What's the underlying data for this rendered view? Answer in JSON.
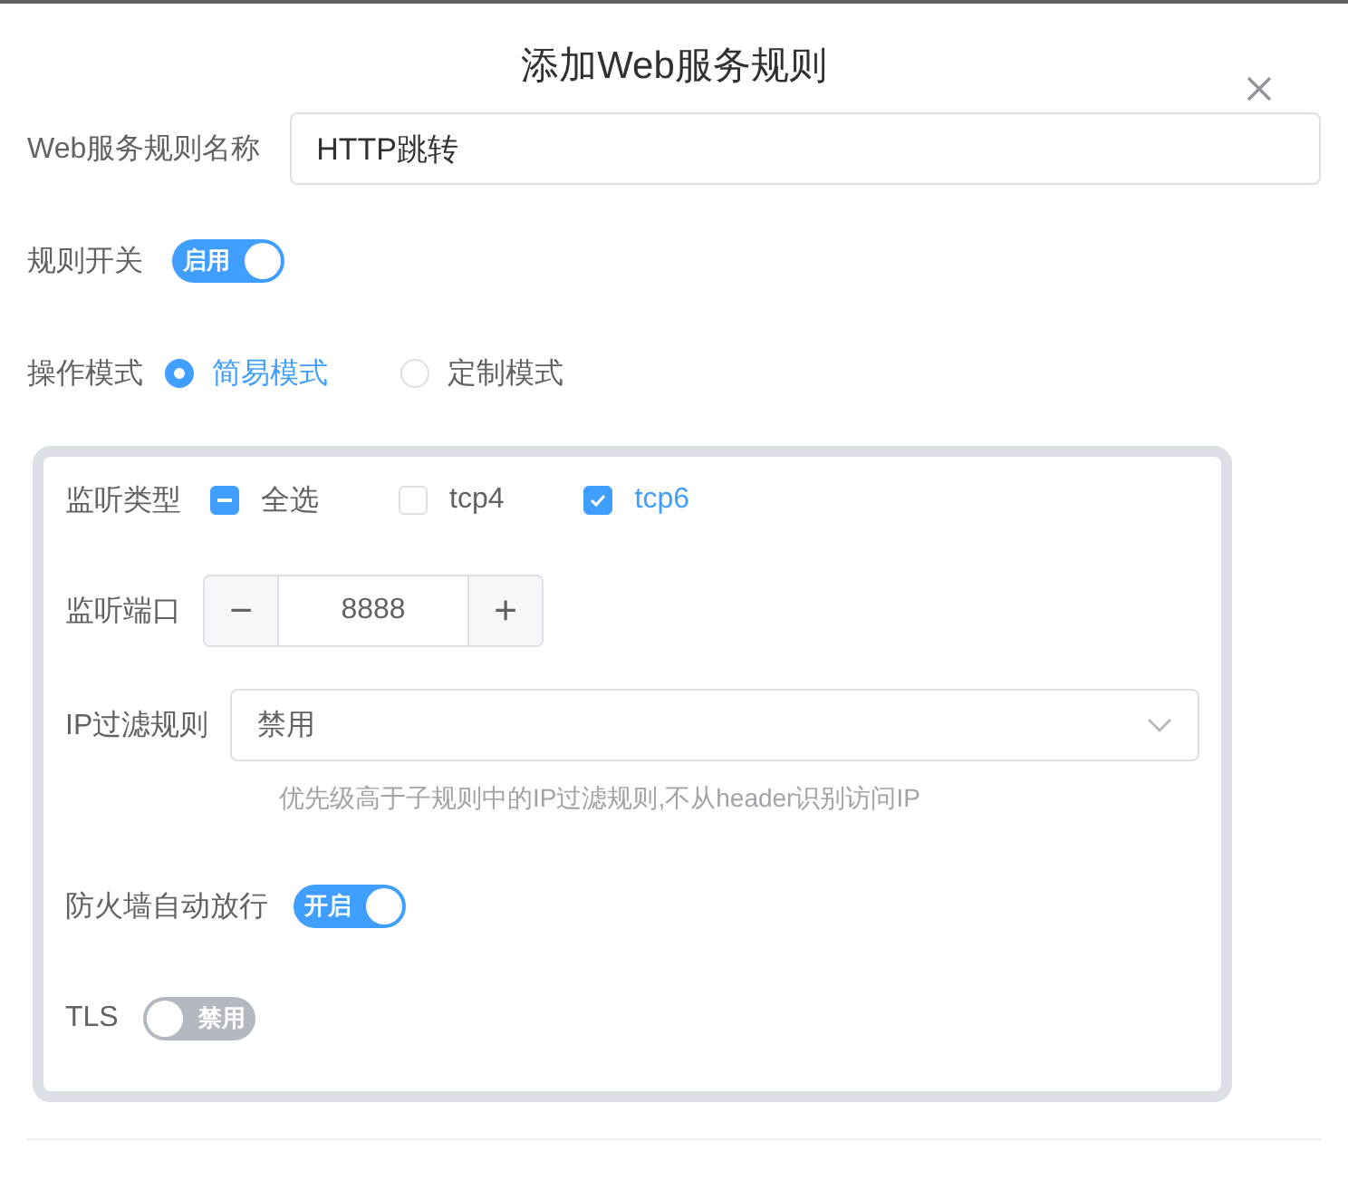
{
  "dialog": {
    "title": "添加Web服务规则"
  },
  "name_field": {
    "label": "Web服务规则名称",
    "value": "HTTP跳转"
  },
  "rule_switch": {
    "label": "规则开关",
    "on": true,
    "text": "启用"
  },
  "mode": {
    "label": "操作模式",
    "options": [
      {
        "label": "简易模式",
        "selected": true
      },
      {
        "label": "定制模式",
        "selected": false
      }
    ]
  },
  "listen_type": {
    "label": "监听类型",
    "options": [
      {
        "label": "全选",
        "checked": false,
        "indeterminate": true
      },
      {
        "label": "tcp4",
        "checked": false,
        "indeterminate": false
      },
      {
        "label": "tcp6",
        "checked": true,
        "indeterminate": false
      }
    ]
  },
  "listen_port": {
    "label": "监听端口",
    "value": "8888",
    "minus": "−",
    "plus": "+"
  },
  "ip_filter": {
    "label": "IP过滤规则",
    "value": "禁用",
    "hint": "优先级高于子规则中的IP过滤规则,不从header识别访问IP"
  },
  "firewall": {
    "label": "防火墙自动放行",
    "on": true,
    "text": "开启"
  },
  "tls": {
    "label": "TLS",
    "on": false,
    "text": "禁用"
  }
}
